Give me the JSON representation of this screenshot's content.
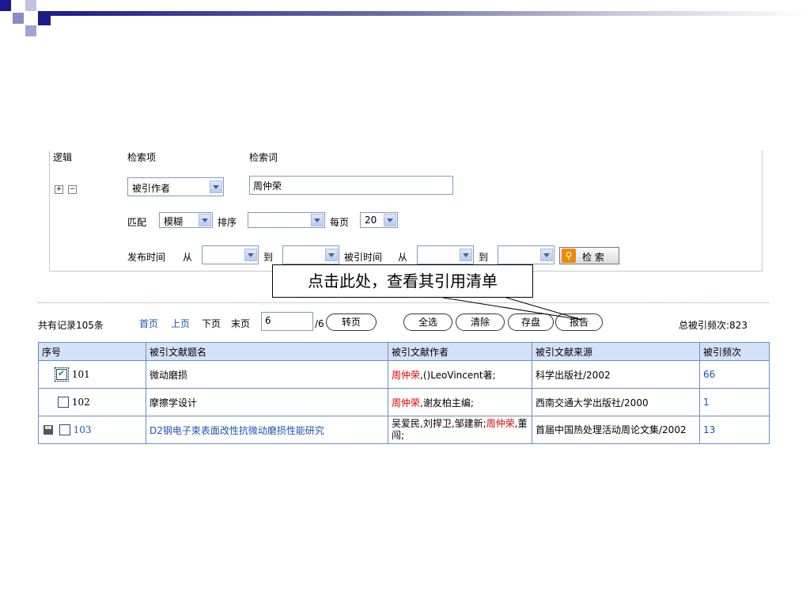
{
  "search": {
    "headers": {
      "logic": "逻辑",
      "field": "检索项",
      "term": "检索词"
    },
    "plus": "+",
    "minus": "−",
    "field_value": "被引作者",
    "term_value": "周仲荣",
    "match_label": "匹配",
    "match_value": "模糊",
    "sort_label": "排序",
    "sort_value": "",
    "perpage_label": "每页",
    "perpage_value": "20",
    "date_label": "发布时间",
    "from_label": "从",
    "to_label": "到",
    "cited_time_label": "被引时间",
    "cited_from_label": "从",
    "cited_to_label": "到",
    "search_button": "检 索"
  },
  "callout": {
    "text": "点击此处，查看其引用清单"
  },
  "toolbar": {
    "total_records": "共有记录105条",
    "first": "首页",
    "prev": "上页",
    "next": "下页",
    "last": "末页",
    "page_value": "6",
    "page_total": "/6",
    "goto": "转页",
    "select_all": "全选",
    "clear": "清除",
    "save": "存盘",
    "report": "报告",
    "total_cited": "总被引频次:823"
  },
  "table": {
    "headers": [
      "序号",
      "被引文献题名",
      "被引文献作者",
      "被引文献来源",
      "被引频次"
    ],
    "rows": [
      {
        "num": "101",
        "title": "微动磨损",
        "author_hl": "周仲荣",
        "author_rest": ",()LeoVincent著;",
        "source": "科学出版社/2002",
        "count": "66",
        "checked": true
      },
      {
        "num": "102",
        "title": "摩擦学设计",
        "author_hl": "周仲荣",
        "author_rest": ",谢友柏主编;",
        "source": "西南交通大学出版社/2000",
        "count": "1",
        "checked": false
      },
      {
        "num": "103",
        "title": "D2钢电子束表面改性抗微动磨损性能研究",
        "author_pre": "吴爱民,刘捍卫,邹建新;",
        "author_hl": "周仲荣",
        "author_rest": ",董闯;",
        "source": "首届中国热处理活动周论文集/2002",
        "count": "13",
        "checked": false
      }
    ]
  },
  "colors": {
    "accent": "#1a1a8c",
    "highlight": "#e00000",
    "link": "#1a56b0",
    "header_bg": "#d4e1f6"
  }
}
